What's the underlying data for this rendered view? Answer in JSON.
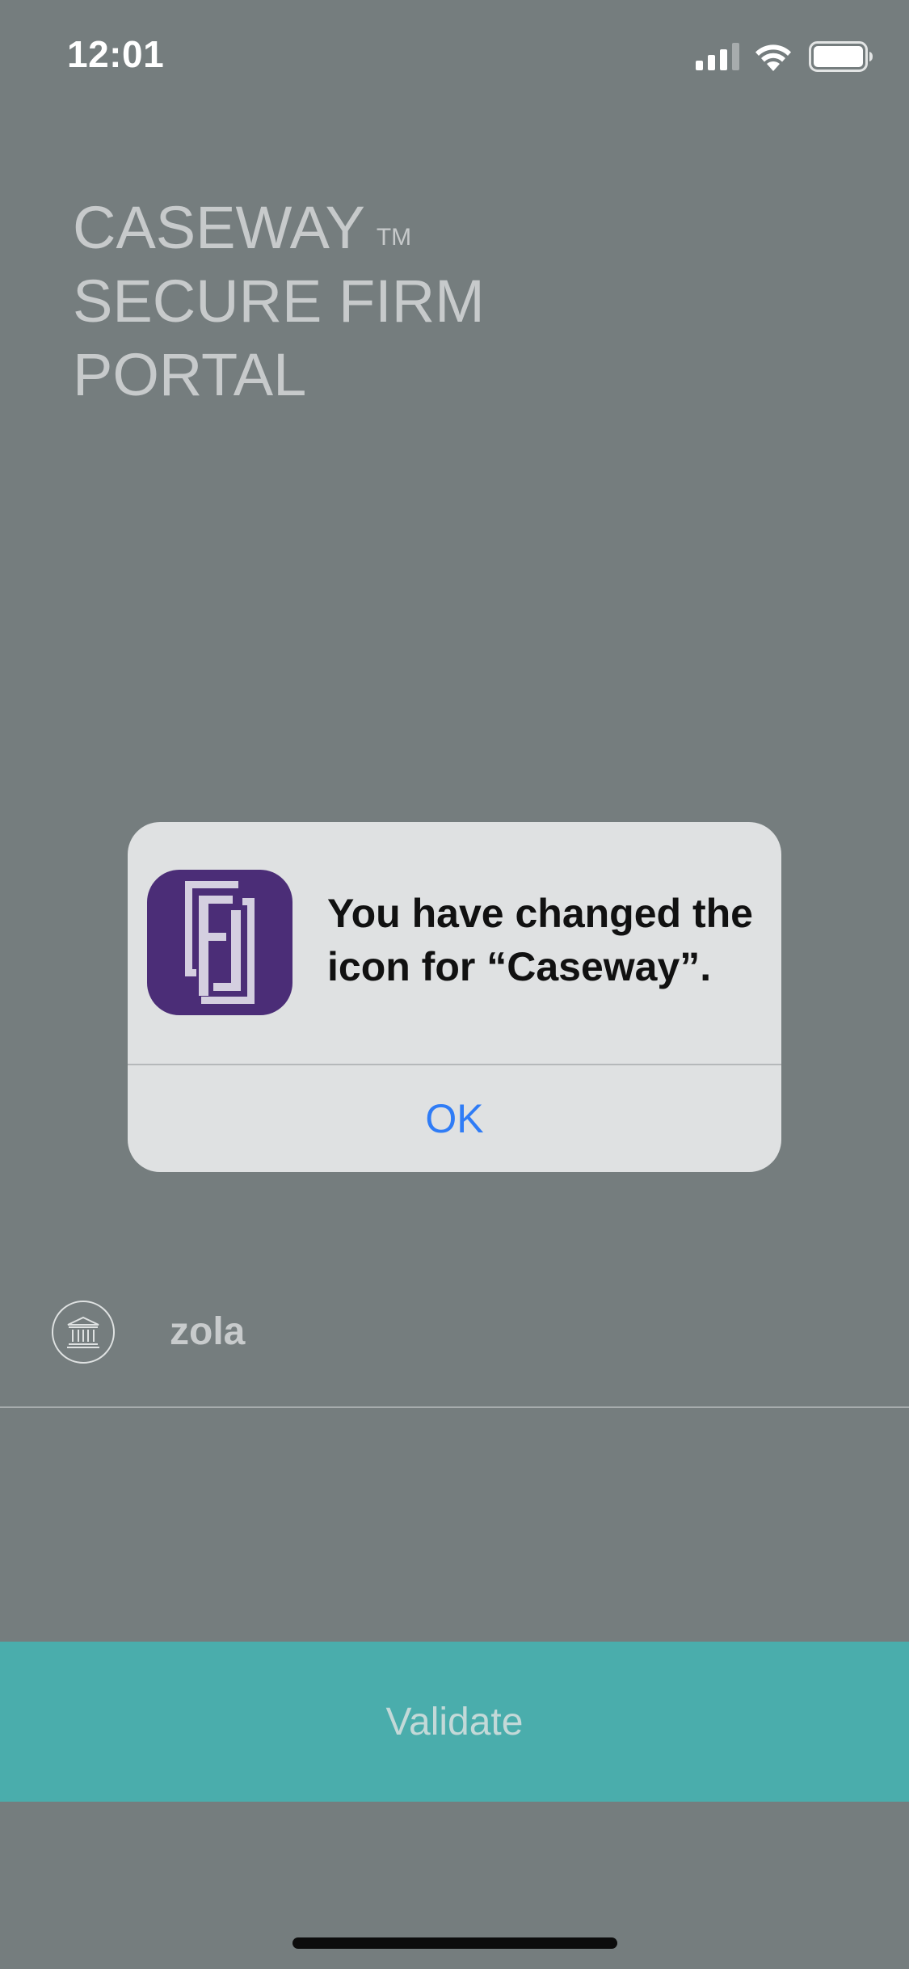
{
  "status_bar": {
    "time": "12:01",
    "icons": [
      "signal-icon",
      "wifi-icon",
      "battery-icon"
    ]
  },
  "header": {
    "title_line1": "CASEWAY",
    "trademark": "TM",
    "title_line2": "SECURE FIRM",
    "title_line3": "PORTAL"
  },
  "firm": {
    "icon": "bank-icon",
    "name": "zola"
  },
  "validate_button": {
    "label": "Validate"
  },
  "alert": {
    "message": "You have changed the icon for “Caseway”.",
    "ok_label": "OK",
    "app_icon": "caseway-app-icon"
  },
  "colors": {
    "background": "#757d7e",
    "accent": "#4aadac",
    "alert_background": "#dfe1e2",
    "link_blue": "#2f7cf6",
    "app_icon_purple": "#4b2d77"
  }
}
